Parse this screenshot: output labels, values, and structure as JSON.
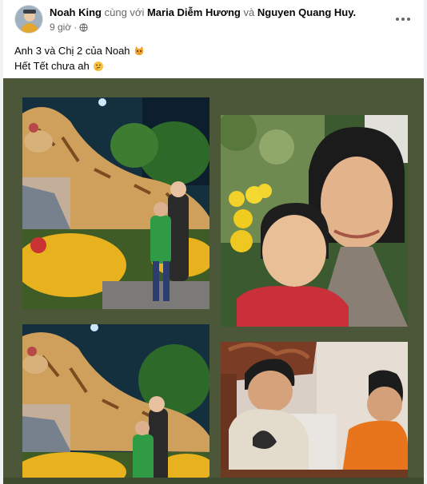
{
  "post": {
    "author": "Noah King",
    "with_text": "cùng với",
    "tagged_1": "Maria Diễm Hương",
    "and_text": "và",
    "tagged_2": "Nguyen Quang Huy",
    "period": ".",
    "time": "9 giờ",
    "separator": "·",
    "privacy_icon": "globe-icon",
    "more_icon": "more-options-icon",
    "caption_line_1": "Anh 3 và Chị 2 của Noah",
    "caption_line_1_emoji": "cat-face-emoji",
    "caption_line_2": "Hết Tết chưa ah",
    "caption_line_2_emoji": "thinking-face-emoji"
  },
  "colors": {
    "background": "#f0f2f5",
    "media_background": "#4c5638",
    "name_text": "#050505",
    "secondary_text": "#65676b"
  },
  "photos": [
    {
      "subject": "tiger-flower-display-mother-son"
    },
    {
      "subject": "selfie-man-and-boy-yellow-flowers"
    },
    {
      "subject": "tiger-flower-display-mother-son-2"
    },
    {
      "subject": "man-and-boy-indoors"
    }
  ]
}
